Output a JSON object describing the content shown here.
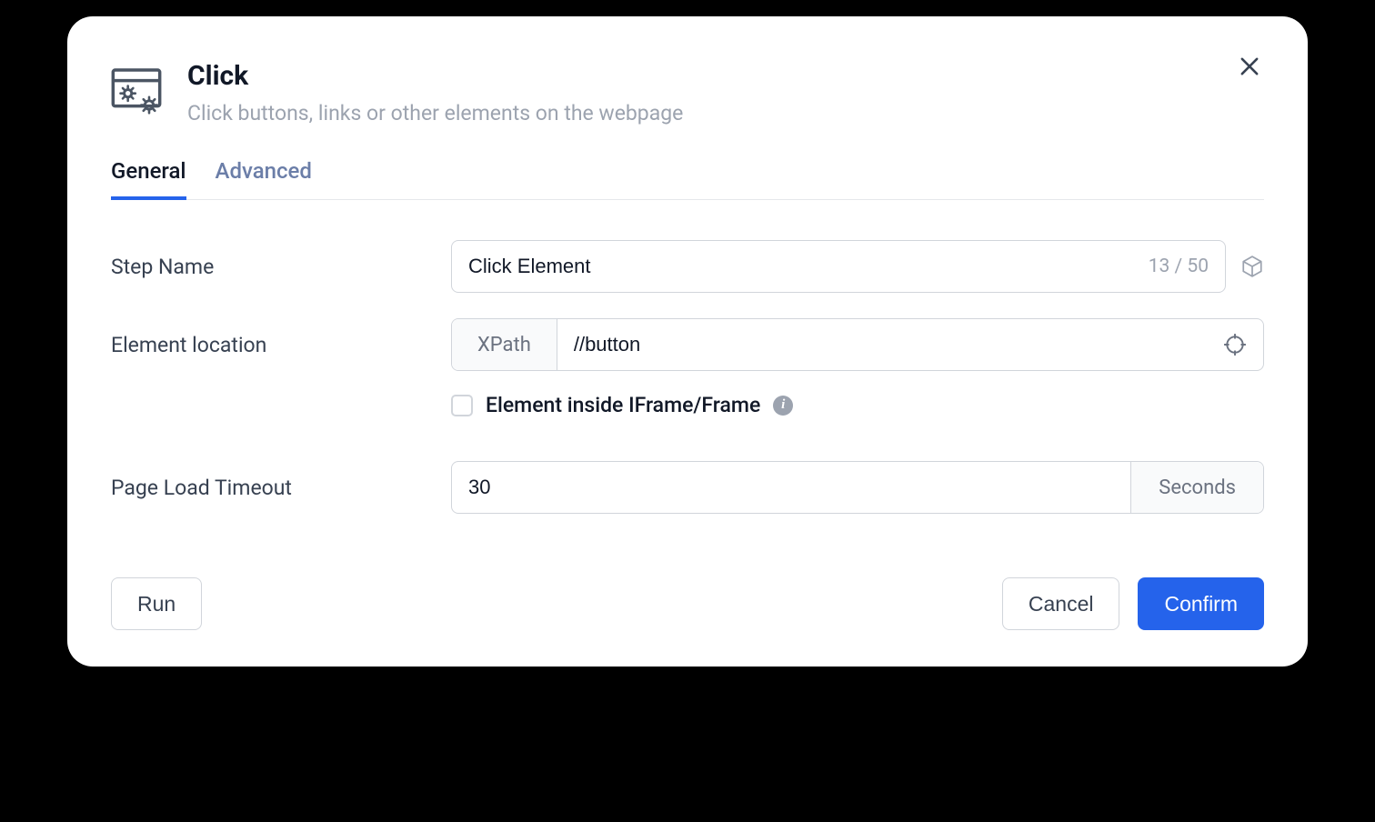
{
  "header": {
    "title": "Click",
    "subtitle": "Click buttons, links or other elements on the webpage"
  },
  "tabs": {
    "general": "General",
    "advanced": "Advanced"
  },
  "form": {
    "step_name": {
      "label": "Step Name",
      "value": "Click Element",
      "counter": "13 / 50"
    },
    "element_location": {
      "label": "Element location",
      "selector_type": "XPath",
      "value": "//button"
    },
    "iframe": {
      "label": "Element inside IFrame/Frame",
      "checked": false
    },
    "page_load_timeout": {
      "label": "Page Load Timeout",
      "value": "30",
      "unit": "Seconds"
    }
  },
  "footer": {
    "run": "Run",
    "cancel": "Cancel",
    "confirm": "Confirm"
  }
}
